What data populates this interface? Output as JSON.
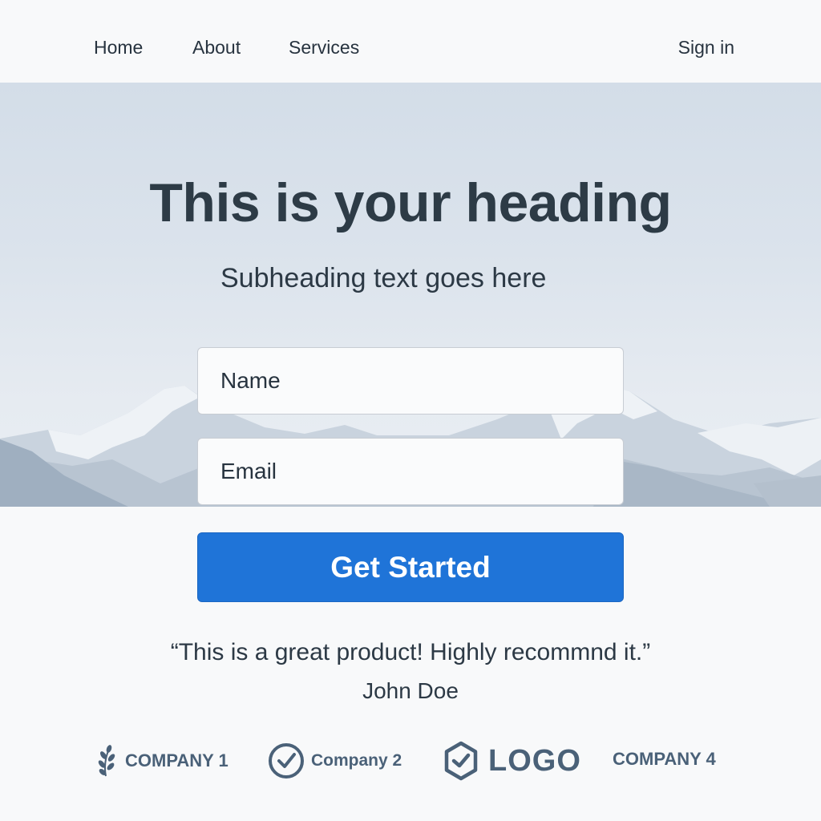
{
  "nav": {
    "items": [
      "Home",
      "About",
      "Services"
    ],
    "sign_in": "Sign in"
  },
  "hero": {
    "title": "This is your heading",
    "subtitle": "Subheading text goes here"
  },
  "form": {
    "name_placeholder": "Name",
    "email_placeholder": "Email",
    "submit_label": "Get Started"
  },
  "testimonial": {
    "quote": "“This is a great product! Highly recommnd it.”",
    "author": "John Doe"
  },
  "logos": {
    "company1": "COMPANY 1",
    "company2": "Company 2",
    "logo": "LOGO",
    "company4": "COMPANY 4"
  },
  "colors": {
    "accent": "#1f74d8",
    "text": "#2d3b46",
    "hero_bg": "#d3dde8",
    "logo_text": "#4a6178"
  },
  "icons": [
    "laurel-icon",
    "check-circle-icon",
    "hexagon-check-icon"
  ]
}
